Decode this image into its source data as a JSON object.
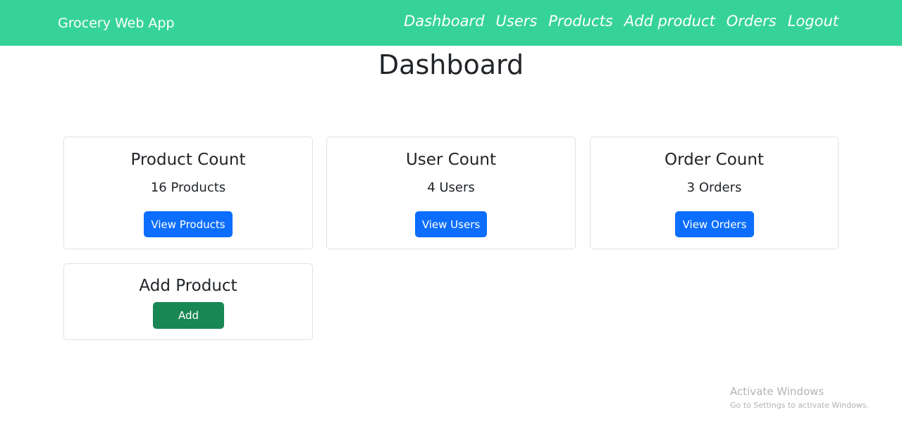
{
  "navbar": {
    "brand": "Grocery Web App",
    "links": [
      "Dashboard",
      "Users",
      "Products",
      "Add product",
      "Orders",
      "Logout"
    ]
  },
  "page": {
    "title": "Dashboard"
  },
  "cards": {
    "products": {
      "title": "Product Count",
      "value": "16 Products",
      "button": "View Products"
    },
    "users": {
      "title": "User Count",
      "value": "4 Users",
      "button": "View Users"
    },
    "orders": {
      "title": "Order Count",
      "value": "3 Orders",
      "button": "View Orders"
    },
    "add": {
      "title": "Add Product",
      "button": "Add"
    }
  },
  "watermark": {
    "title": "Activate Windows",
    "subtitle": "Go to Settings to activate Windows."
  },
  "colors": {
    "navbar": "#36d399",
    "primary": "#0d6efd",
    "success": "#198754"
  }
}
